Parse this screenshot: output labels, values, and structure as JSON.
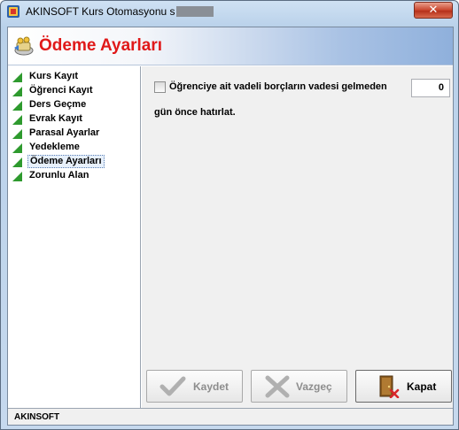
{
  "window": {
    "title": "AKINSOFT Kurs Otomasyonu s",
    "close_glyph": "✕"
  },
  "header": {
    "title": "Ödeme Ayarları",
    "icon": "settings-wizard-icon"
  },
  "sidebar": {
    "items": [
      {
        "label": "Kurs Kayıt",
        "selected": false
      },
      {
        "label": "Öğrenci Kayıt",
        "selected": false
      },
      {
        "label": "Ders Geçme",
        "selected": false
      },
      {
        "label": "Evrak Kayıt",
        "selected": false
      },
      {
        "label": "Parasal Ayarlar",
        "selected": false
      },
      {
        "label": "Yedekleme",
        "selected": false
      },
      {
        "label": "Ödeme Ayarları",
        "selected": true
      },
      {
        "label": "Zorunlu Alan",
        "selected": false
      }
    ],
    "item_icon": "green-triangle-icon",
    "item_color": "#2e9a2e"
  },
  "settings": {
    "reminder_checkbox_label": "Öğrenciye ait vadeli borçların vadesi gelmeden",
    "reminder_checked": false,
    "days_value": "0",
    "reminder_suffix": "gün önce hatırlat."
  },
  "buttons": {
    "save_label": "Kaydet",
    "cancel_label": "Vazgeç",
    "close_label": "Kapat"
  },
  "status": {
    "text": "AKINSOFT"
  },
  "colors": {
    "header_title": "#e01919",
    "disabled_text": "#8d8d8d"
  }
}
